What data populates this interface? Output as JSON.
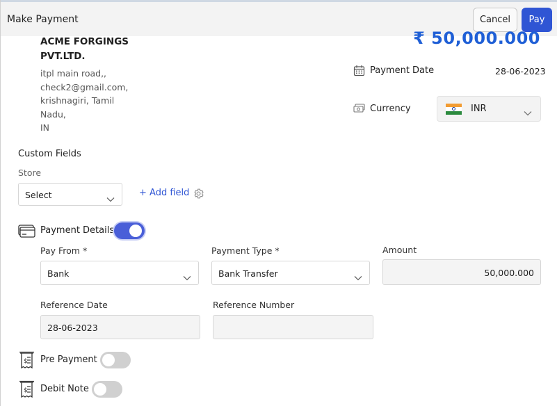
{
  "header": {
    "title": "Make Payment",
    "cancel_label": "Cancel",
    "pay_label": "Pay"
  },
  "vendor": {
    "name": "ACME FORGINGS PVT.LTD.",
    "address_lines": [
      "itpl main road,,",
      "check2@gmail.com,",
      "krishnagiri, Tamil",
      "Nadu,",
      "IN"
    ]
  },
  "amount_display": "₹ 50,000.000",
  "payment_date": {
    "label": "Payment Date",
    "value": "28-06-2023"
  },
  "currency": {
    "label": "Currency",
    "value": "INR",
    "flag_colors": [
      "#f29c33",
      "#ffffff",
      "#2b8a3e"
    ]
  },
  "custom_fields": {
    "title": "Custom Fields",
    "store_label": "Store",
    "store_value": "Select",
    "add_field_label": "+ Add field"
  },
  "payment_details": {
    "title": "Payment Details",
    "enabled": true,
    "pay_from_label": "Pay From *",
    "pay_from_value": "Bank",
    "payment_type_label": "Payment Type *",
    "payment_type_value": "Bank Transfer",
    "amount_label": "Amount",
    "amount_value": "50,000.000",
    "reference_date_label": "Reference Date",
    "reference_date_value": "28-06-2023",
    "reference_number_label": "Reference Number",
    "reference_number_value": ""
  },
  "pre_payment": {
    "label": "Pre Payment",
    "enabled": false
  },
  "debit_note": {
    "label": "Debit Note",
    "enabled": false
  },
  "colors": {
    "accent": "#2f55d4",
    "amount": "#1f5fd6",
    "toggle_on": "#4a5fd8",
    "toggle_off": "#d0d0d0"
  }
}
